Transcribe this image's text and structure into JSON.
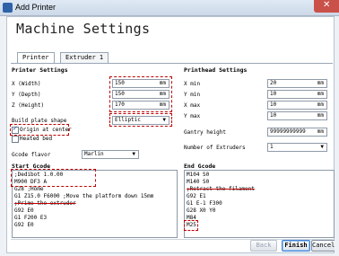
{
  "window": {
    "title": "Add Printer",
    "close_glyph": "✕"
  },
  "heading": "Machine Settings",
  "tabs": [
    {
      "label": "Printer"
    },
    {
      "label": "Extruder 1"
    }
  ],
  "printer_settings": {
    "title": "Printer Settings",
    "width": {
      "label": "X (Width)",
      "value": "150",
      "unit": "mm"
    },
    "depth": {
      "label": "Y (Depth)",
      "value": "150",
      "unit": "mm"
    },
    "height": {
      "label": "Z (Height)",
      "value": "170",
      "unit": "mm"
    },
    "build_plate": {
      "label": "Build plate shape",
      "value": "Elliptic"
    },
    "origin_center": {
      "label": "Origin at center",
      "checked": true
    },
    "heated_bed": {
      "label": "Heated bed",
      "checked": false
    },
    "gcode_flavor": {
      "label": "Gcode flavor",
      "value": "Marlin"
    }
  },
  "printhead_settings": {
    "title": "Printhead Settings",
    "xmin": {
      "label": "X min",
      "value": "20",
      "unit": "mm"
    },
    "ymin": {
      "label": "Y min",
      "value": "10",
      "unit": "mm"
    },
    "xmax": {
      "label": "X max",
      "value": "10",
      "unit": "mm"
    },
    "ymax": {
      "label": "Y max",
      "value": "10",
      "unit": "mm"
    },
    "gantry": {
      "label": "Gantry height",
      "value": "99999999999",
      "unit": "mm"
    },
    "extruders": {
      "label": "Number of Extruders",
      "value": "1"
    }
  },
  "start_gcode": {
    "title": "Start Gcode",
    "lines": [
      ";Dedibot 1.0.00",
      "M900 DF3 A",
      "G28 ;Home",
      "G1 Z15.0 F6000 ;Move the platform down 15mm",
      ";Prime the extruder",
      "G92 E0",
      "G1 F200 E3",
      "G92 E0"
    ]
  },
  "end_gcode": {
    "title": "End Gcode",
    "lines": [
      "M104 S0",
      "M140 S0",
      ";Retract the filament",
      "G92 E1",
      "G1 E-1 F300",
      "G28 X0 Y0",
      "M84",
      "M25"
    ]
  },
  "buttons": {
    "back": "Back",
    "finish": "Finish",
    "cancel": "Cancel"
  },
  "colors": {
    "annotation": "#c00000",
    "accent": "#2e63a8"
  }
}
